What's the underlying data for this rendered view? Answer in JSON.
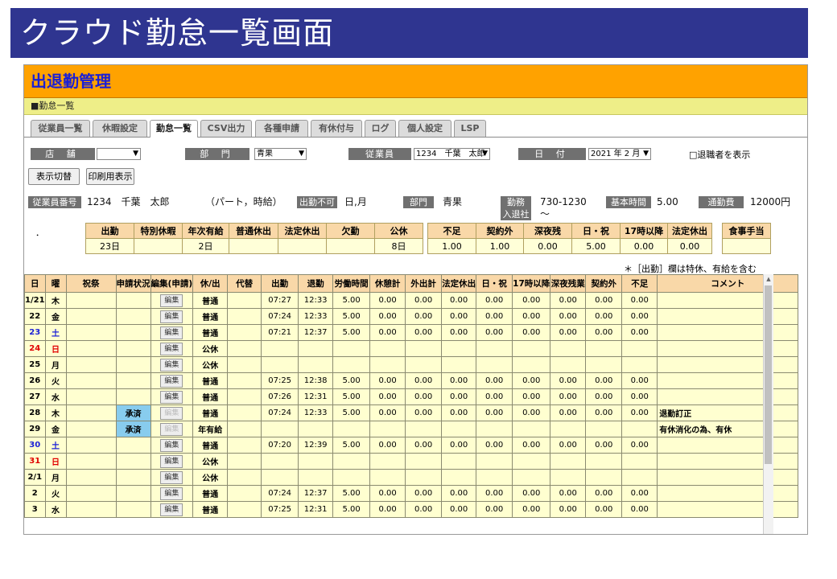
{
  "slide_title": "クラウド勤怠一覧画面",
  "app_title": "出退勤管理",
  "breadcrumb": "■勤怠一覧",
  "tabs": [
    "従業員一覧",
    "休暇設定",
    "勤怠一覧",
    "CSV出力",
    "各種申請",
    "有休付与",
    "ログ",
    "個人設定",
    "LSP"
  ],
  "active_tab": "勤怠一覧",
  "filters": {
    "store_label": "店 舗",
    "store_value": "",
    "dept_label": "部 門",
    "dept_value": "青果",
    "employee_label": "従業員",
    "employee_value": "1234　千葉　太郎",
    "date_label": "日 付",
    "date_value": "2021 年 2 月",
    "show_retired": "□退職者を表示"
  },
  "buttons": {
    "toggle": "表示切替",
    "print": "印刷用表示"
  },
  "employee_info": {
    "id_label": "従業員番号",
    "id_value": "1234　千葉　太郎",
    "type_value": "（パート，時給）",
    "no_work_label": "出勤不可",
    "no_work_value": "日,月",
    "dept_label": "部門",
    "dept_value": "青果",
    "shift_label": "勤務",
    "shift_value": "730-1230",
    "hire_label": "入退社",
    "hire_value": "〜",
    "base_time_label": "基本時間",
    "base_time_value": "5.00",
    "commute_label": "通勤費",
    "commute_value": "12000円"
  },
  "summary_dot": "．",
  "summary1": {
    "headers": [
      "出勤",
      "特別休暇",
      "年次有給",
      "普通休出",
      "法定休出",
      "欠勤",
      "公休"
    ],
    "values": [
      "23日",
      "",
      "2日",
      "",
      "",
      "",
      "8日"
    ]
  },
  "summary2": {
    "headers": [
      "不足",
      "契約外",
      "深夜残",
      "日・祝",
      "17時以降",
      "法定休出"
    ],
    "values": [
      "1.00",
      "1.00",
      "0.00",
      "5.00",
      "0.00",
      "0.00"
    ]
  },
  "summary3": {
    "headers": [
      "食事手当"
    ],
    "values": [
      ""
    ]
  },
  "note": "＊［出勤］欄は特休、有給を含む",
  "grid": {
    "headers": [
      "日",
      "曜",
      "祝祭",
      "申請状況",
      "編集(申請)",
      "休/出",
      "代替",
      "出勤",
      "退勤",
      "労働時間",
      "休憩計",
      "外出計",
      "法定休出",
      "日・祝",
      "17時以降",
      "深夜残業",
      "契約外",
      "不足",
      "コメント"
    ],
    "edit_label": "編集",
    "rows": [
      {
        "d": "1/21",
        "w": "木",
        "wc": "",
        "st": "",
        "ed": true,
        "k": "普通",
        "in": "07:27",
        "out": "12:33",
        "n": [
          "5.00",
          "0.00",
          "0.00",
          "0.00",
          "0.00",
          "0.00",
          "0.00",
          "0.00",
          "0.00"
        ],
        "c": ""
      },
      {
        "d": "22",
        "w": "金",
        "wc": "",
        "st": "",
        "ed": true,
        "k": "普通",
        "in": "07:24",
        "out": "12:33",
        "n": [
          "5.00",
          "0.00",
          "0.00",
          "0.00",
          "0.00",
          "0.00",
          "0.00",
          "0.00",
          "0.00"
        ],
        "c": ""
      },
      {
        "d": "23",
        "w": "土",
        "wc": "blue",
        "st": "",
        "ed": true,
        "k": "普通",
        "in": "07:21",
        "out": "12:37",
        "n": [
          "5.00",
          "0.00",
          "0.00",
          "0.00",
          "0.00",
          "0.00",
          "0.00",
          "0.00",
          "0.00"
        ],
        "c": ""
      },
      {
        "d": "24",
        "w": "日",
        "wc": "red",
        "st": "",
        "ed": true,
        "k": "公休",
        "in": "",
        "out": "",
        "n": [
          "",
          "",
          "",
          "",
          "",
          "",
          "",
          "",
          ""
        ],
        "c": ""
      },
      {
        "d": "25",
        "w": "月",
        "wc": "",
        "st": "",
        "ed": true,
        "k": "公休",
        "in": "",
        "out": "",
        "n": [
          "",
          "",
          "",
          "",
          "",
          "",
          "",
          "",
          ""
        ],
        "c": ""
      },
      {
        "d": "26",
        "w": "火",
        "wc": "",
        "st": "",
        "ed": true,
        "k": "普通",
        "in": "07:25",
        "out": "12:38",
        "n": [
          "5.00",
          "0.00",
          "0.00",
          "0.00",
          "0.00",
          "0.00",
          "0.00",
          "0.00",
          "0.00"
        ],
        "c": ""
      },
      {
        "d": "27",
        "w": "水",
        "wc": "",
        "st": "",
        "ed": true,
        "k": "普通",
        "in": "07:26",
        "out": "12:31",
        "n": [
          "5.00",
          "0.00",
          "0.00",
          "0.00",
          "0.00",
          "0.00",
          "0.00",
          "0.00",
          "0.00"
        ],
        "c": ""
      },
      {
        "d": "28",
        "w": "木",
        "wc": "",
        "st": "承済",
        "ed": false,
        "k": "普通",
        "in": "07:24",
        "out": "12:33",
        "n": [
          "5.00",
          "0.00",
          "0.00",
          "0.00",
          "0.00",
          "0.00",
          "0.00",
          "0.00",
          "0.00"
        ],
        "c": "退勤訂正"
      },
      {
        "d": "29",
        "w": "金",
        "wc": "",
        "st": "承済",
        "ed": false,
        "k": "年有給",
        "in": "",
        "out": "",
        "n": [
          "",
          "",
          "",
          "",
          "",
          "",
          "",
          "",
          ""
        ],
        "c": "有休消化の為、有休"
      },
      {
        "d": "30",
        "w": "土",
        "wc": "blue",
        "st": "",
        "ed": true,
        "k": "普通",
        "in": "07:20",
        "out": "12:39",
        "n": [
          "5.00",
          "0.00",
          "0.00",
          "0.00",
          "0.00",
          "0.00",
          "0.00",
          "0.00",
          "0.00"
        ],
        "c": ""
      },
      {
        "d": "31",
        "w": "日",
        "wc": "red",
        "st": "",
        "ed": true,
        "k": "公休",
        "in": "",
        "out": "",
        "n": [
          "",
          "",
          "",
          "",
          "",
          "",
          "",
          "",
          ""
        ],
        "c": ""
      },
      {
        "d": "2/1",
        "w": "月",
        "wc": "",
        "st": "",
        "ed": true,
        "k": "公休",
        "in": "",
        "out": "",
        "n": [
          "",
          "",
          "",
          "",
          "",
          "",
          "",
          "",
          ""
        ],
        "c": ""
      },
      {
        "d": "2",
        "w": "火",
        "wc": "",
        "st": "",
        "ed": true,
        "k": "普通",
        "in": "07:24",
        "out": "12:37",
        "n": [
          "5.00",
          "0.00",
          "0.00",
          "0.00",
          "0.00",
          "0.00",
          "0.00",
          "0.00",
          "0.00"
        ],
        "c": ""
      },
      {
        "d": "3",
        "w": "水",
        "wc": "",
        "st": "",
        "ed": true,
        "k": "普通",
        "in": "07:25",
        "out": "12:31",
        "n": [
          "5.00",
          "0.00",
          "0.00",
          "0.00",
          "0.00",
          "0.00",
          "0.00",
          "0.00",
          "0.00"
        ],
        "c": ""
      }
    ]
  }
}
